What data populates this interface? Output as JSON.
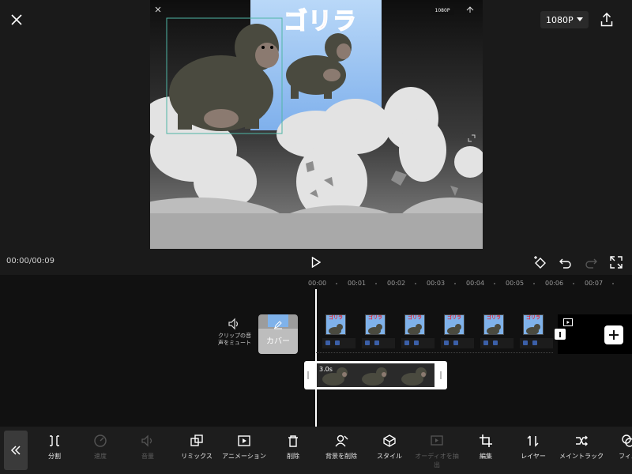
{
  "header": {
    "close_icon": "close-icon",
    "resolution": "1080P",
    "export_icon": "export-icon"
  },
  "preview": {
    "title": "ゴリラ",
    "mini_resolution": "1080P"
  },
  "playback": {
    "time": "00:00/00:09",
    "play_icon": "play-icon",
    "keyframe_icon": "keyframe-icon",
    "undo_icon": "undo-icon",
    "redo_icon": "redo-icon",
    "fullscreen_icon": "fullscreen-icon"
  },
  "timeline": {
    "ruler": [
      "00:00",
      "00:01",
      "00:02",
      "00:03",
      "00:04",
      "00:05",
      "00:06",
      "00:07"
    ],
    "mute_label_1": "クリップの音",
    "mute_label_2": "声をミュート",
    "cover_label": "カバー",
    "frame_text": "ゴリラ",
    "selected_clip_duration": "3.0s",
    "accent": "#3b5fa8"
  },
  "toolbar": {
    "items": [
      {
        "label": "分割",
        "enabled": true,
        "icon": "split-icon"
      },
      {
        "label": "速度",
        "enabled": false,
        "icon": "speed-icon"
      },
      {
        "label": "音量",
        "enabled": false,
        "icon": "volume-icon"
      },
      {
        "label": "リミックス",
        "enabled": true,
        "icon": "remix-icon"
      },
      {
        "label": "アニメーション",
        "enabled": true,
        "icon": "animation-icon"
      },
      {
        "label": "削除",
        "enabled": true,
        "icon": "trash-icon"
      },
      {
        "label": "背景を削除",
        "enabled": true,
        "icon": "remove-bg-icon"
      },
      {
        "label": "スタイル",
        "enabled": true,
        "icon": "style-icon"
      },
      {
        "label": "オーディオを抽出",
        "enabled": false,
        "icon": "extract-audio-icon"
      },
      {
        "label": "編集",
        "enabled": true,
        "icon": "crop-icon"
      },
      {
        "label": "レイヤー",
        "enabled": true,
        "icon": "layer-icon"
      },
      {
        "label": "メイントラック",
        "enabled": true,
        "icon": "main-track-icon"
      },
      {
        "label": "フィル",
        "enabled": true,
        "icon": "filter-icon"
      }
    ]
  }
}
